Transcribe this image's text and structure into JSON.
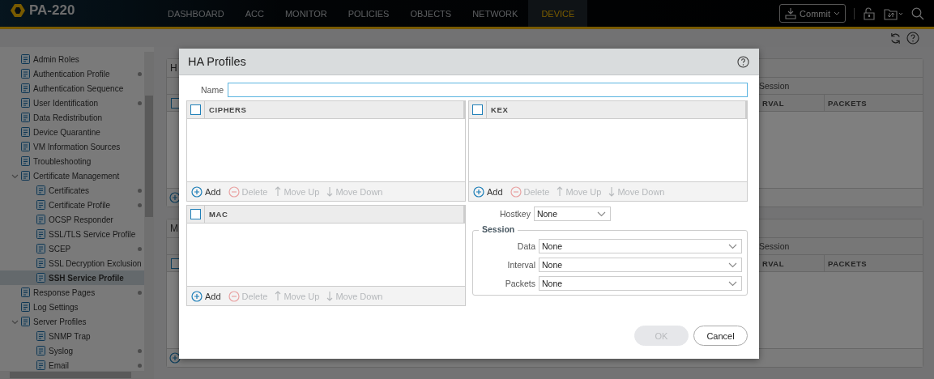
{
  "brand": {
    "title": "PA-220"
  },
  "nav_tabs": [
    {
      "label": "DASHBOARD",
      "selected": false
    },
    {
      "label": "ACC",
      "selected": false
    },
    {
      "label": "MONITOR",
      "selected": false
    },
    {
      "label": "POLICIES",
      "selected": false
    },
    {
      "label": "OBJECTS",
      "selected": false
    },
    {
      "label": "NETWORK",
      "selected": false
    },
    {
      "label": "DEVICE",
      "selected": true
    }
  ],
  "commit_button": {
    "label": "Commit"
  },
  "sidebar": {
    "items": [
      {
        "label": "Admin Roles",
        "marked": false,
        "selected": false
      },
      {
        "label": "Authentication Profile",
        "marked": true,
        "selected": false
      },
      {
        "label": "Authentication Sequence",
        "marked": false,
        "selected": false
      },
      {
        "label": "User Identification",
        "marked": true,
        "selected": false
      },
      {
        "label": "Data Redistribution",
        "marked": false,
        "selected": false
      },
      {
        "label": "Device Quarantine",
        "marked": false,
        "selected": false
      },
      {
        "label": "VM Information Sources",
        "marked": false,
        "selected": false
      },
      {
        "label": "Troubleshooting",
        "marked": false,
        "selected": false
      },
      {
        "label": "Certificate Management",
        "marked": false,
        "selected": false,
        "expanded": true,
        "children": [
          {
            "label": "Certificates",
            "marked": true,
            "selected": false
          },
          {
            "label": "Certificate Profile",
            "marked": true,
            "selected": false
          },
          {
            "label": "OCSP Responder",
            "marked": false,
            "selected": false
          },
          {
            "label": "SSL/TLS Service Profile",
            "marked": false,
            "selected": false
          },
          {
            "label": "SCEP",
            "marked": true,
            "selected": false
          },
          {
            "label": "SSL Decryption Exclusion",
            "marked": false,
            "selected": false
          },
          {
            "label": "SSH Service Profile",
            "marked": false,
            "selected": true
          }
        ]
      },
      {
        "label": "Response Pages",
        "marked": true,
        "selected": false
      },
      {
        "label": "Log Settings",
        "marked": false,
        "selected": false
      },
      {
        "label": "Server Profiles",
        "marked": false,
        "selected": false,
        "expanded": true,
        "children": [
          {
            "label": "SNMP Trap",
            "marked": false,
            "selected": false
          },
          {
            "label": "Syslog",
            "marked": true,
            "selected": false
          },
          {
            "label": "Email",
            "marked": true,
            "selected": false
          }
        ]
      }
    ]
  },
  "background_panels": [
    {
      "title": "H",
      "group_header": "Session",
      "select_all_checked": false,
      "columns": [
        "RVAL",
        "PACKETS"
      ]
    },
    {
      "title": "M",
      "group_header": "Session",
      "select_all_checked": false,
      "columns": [
        "RVAL",
        "PACKETS"
      ]
    }
  ],
  "dialog": {
    "title": "HA Profiles",
    "name_field": {
      "label": "Name"
    },
    "lists": [
      {
        "header": "CIPHERS",
        "checked": false,
        "actions": [
          {
            "kind": "add",
            "label": "Add",
            "disabled": false
          },
          {
            "kind": "delete",
            "label": "Delete",
            "disabled": true
          },
          {
            "kind": "up",
            "label": "Move Up",
            "disabled": true
          },
          {
            "kind": "down",
            "label": "Move Down",
            "disabled": true
          }
        ]
      },
      {
        "header": "KEX",
        "checked": false,
        "actions": [
          {
            "kind": "add",
            "label": "Add",
            "disabled": false
          },
          {
            "kind": "delete",
            "label": "Delete",
            "disabled": true
          },
          {
            "kind": "up",
            "label": "Move Up",
            "disabled": true
          },
          {
            "kind": "down",
            "label": "Move Down",
            "disabled": true
          }
        ]
      },
      {
        "header": "MAC",
        "checked": false,
        "actions": [
          {
            "kind": "add",
            "label": "Add",
            "disabled": false
          },
          {
            "kind": "delete",
            "label": "Delete",
            "disabled": true
          },
          {
            "kind": "up",
            "label": "Move Up",
            "disabled": true
          },
          {
            "kind": "down",
            "label": "Move Down",
            "disabled": true
          }
        ]
      }
    ],
    "hostkey": {
      "label": "Hostkey",
      "value": "None"
    },
    "session": {
      "legend": "Session",
      "fields": [
        {
          "label": "Data",
          "value": "None"
        },
        {
          "label": "Interval",
          "value": "None"
        },
        {
          "label": "Packets",
          "value": "None"
        }
      ]
    },
    "buttons": [
      {
        "label": "OK",
        "disabled": true
      },
      {
        "label": "Cancel",
        "disabled": false
      }
    ]
  }
}
